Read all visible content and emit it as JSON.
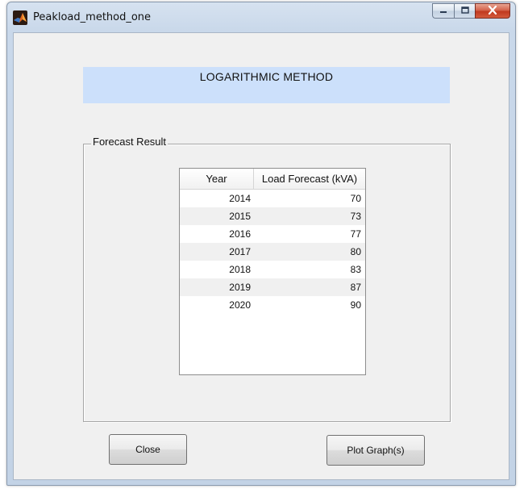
{
  "window": {
    "title": "Peakload_method_one"
  },
  "caption_buttons": {
    "minimize_icon": "minimize-icon",
    "maximize_icon": "maximize-icon",
    "close_icon": "close-icon"
  },
  "banner": {
    "title": "LOGARITHMIC METHOD"
  },
  "forecast_group": {
    "label": "Forecast Result",
    "table": {
      "columns": [
        "Year",
        "Load Forecast (kVA)"
      ],
      "rows": [
        [
          "2014",
          "70"
        ],
        [
          "2015",
          "73"
        ],
        [
          "2016",
          "77"
        ],
        [
          "2017",
          "80"
        ],
        [
          "2018",
          "83"
        ],
        [
          "2019",
          "87"
        ],
        [
          "2020",
          "90"
        ]
      ]
    }
  },
  "buttons": {
    "close_label": "Close",
    "plot_label": "Plot Graph(s)"
  },
  "colors": {
    "banner_background": "#cce0fb",
    "close_button_accent": "#c0391f"
  }
}
